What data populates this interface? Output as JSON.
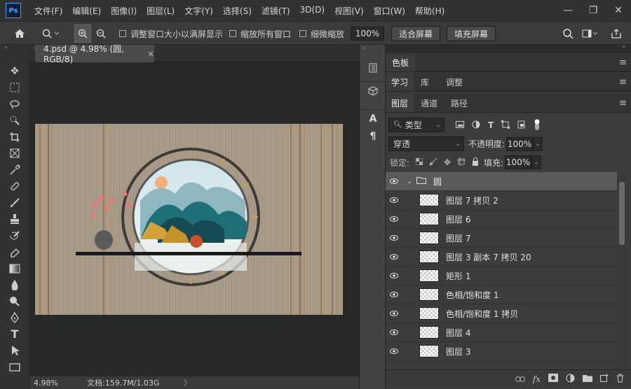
{
  "app": {
    "logo": "Ps"
  },
  "menu": [
    "文件(F)",
    "编辑(E)",
    "图像(I)",
    "图层(L)",
    "文字(Y)",
    "选择(S)",
    "滤镜(T)",
    "3D(D)",
    "视图(V)",
    "窗口(W)",
    "帮助(H)"
  ],
  "window_buttons": [
    "—",
    "❐",
    "✕"
  ],
  "options": {
    "resize_windows_label": "调整窗口大小以满屏显示",
    "zoom_all_label": "缩放所有窗口",
    "scrubby_label": "细微缩放",
    "zoom_value": "100%",
    "fit_screen": "适合屏幕",
    "fill_screen": "填充屏幕"
  },
  "document": {
    "tab_title": "4.psd @ 4.98% (圆, RGB/8)",
    "tab_close": "×"
  },
  "status": {
    "zoom": "4.98%",
    "doc_info": "文档:159.7M/1.03G",
    "arrow": "〉"
  },
  "panels": {
    "color": "色板",
    "learn": "学习",
    "library": "库",
    "adjust": "调整",
    "layers": "图层",
    "channels": "通道",
    "paths": "路径"
  },
  "layers_panel": {
    "filter_kind": "类型",
    "blend_mode": "穿透",
    "opacity_label": "不透明度:",
    "opacity_value": "100%",
    "lock_label": "锁定:",
    "fill_label": "填充:",
    "fill_value": "100%",
    "group_name": "圆",
    "layers": [
      {
        "name": "图层 7 拷贝 2"
      },
      {
        "name": "图层 6"
      },
      {
        "name": "图层 7"
      },
      {
        "name": "图层 3 副本 7 拷贝 20"
      },
      {
        "name": "矩形 1"
      },
      {
        "name": "色相/饱和度 1"
      },
      {
        "name": "色相/饱和度 1 拷贝"
      },
      {
        "name": "图层 4"
      },
      {
        "name": "图层 3"
      }
    ]
  },
  "colors": {
    "accent": "#31a8ff",
    "canvas_wall": "#a89a87",
    "gold": "#d4a23a",
    "teal": "#1f6f78"
  }
}
